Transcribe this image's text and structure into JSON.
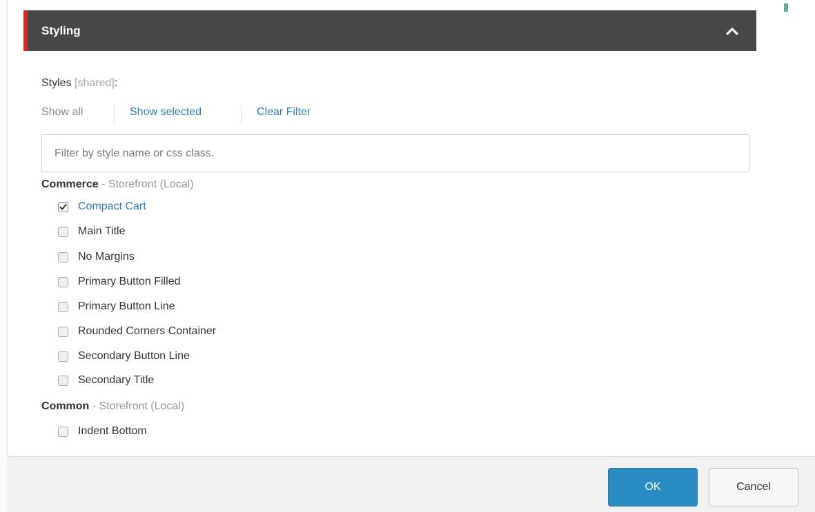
{
  "section": {
    "title": "Styling",
    "collapse_icon": "chevron-up-icon"
  },
  "styles": {
    "label": "Styles",
    "shared": "[shared]",
    "colon": ":"
  },
  "filters": {
    "show_all": "Show all",
    "show_selected": "Show selected",
    "clear": "Clear Filter"
  },
  "search": {
    "placeholder": "Filter by style name or css class.",
    "value": ""
  },
  "groups": [
    {
      "name": "Commerce",
      "sep": " - ",
      "source": "Storefront (Local)",
      "items": [
        {
          "label": "Compact Cart",
          "checked": true
        },
        {
          "label": "Main Title",
          "checked": false
        },
        {
          "label": "No Margins",
          "checked": false
        },
        {
          "label": "Primary Button Filled",
          "checked": false
        },
        {
          "label": "Primary Button Line",
          "checked": false
        },
        {
          "label": "Rounded Corners Container",
          "checked": false
        },
        {
          "label": "Secondary Button Line",
          "checked": false
        },
        {
          "label": "Secondary Title",
          "checked": false
        }
      ]
    },
    {
      "name": "Common",
      "sep": " - ",
      "source": "Storefront (Local)",
      "items": [
        {
          "label": "Indent Bottom",
          "checked": false
        }
      ]
    }
  ],
  "buttons": {
    "ok": "OK",
    "cancel": "Cancel"
  },
  "colors": {
    "header_bg": "#474747",
    "accent_red": "#d32b2b",
    "link_blue": "#2b7db6",
    "ok_blue": "#2a8bc3"
  }
}
